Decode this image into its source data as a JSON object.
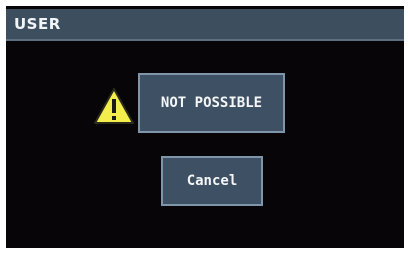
{
  "window": {
    "title": "USER"
  },
  "dialog": {
    "icon": "warning-triangle-icon",
    "message": "NOT POSSIBLE",
    "cancel_label": "Cancel"
  },
  "colors": {
    "screen_background": "#080509",
    "title_bar": "#3d4f5f",
    "panel_fill": "#3e5063",
    "panel_border": "#7f96aa",
    "warning_yellow": "#f4ee4c",
    "text": "#f4f6f8"
  }
}
